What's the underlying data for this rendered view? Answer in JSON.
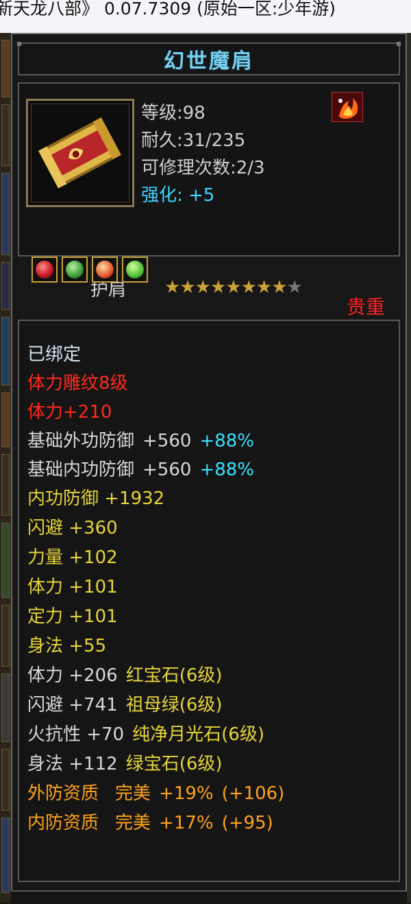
{
  "window": {
    "title": "新天龙八部》 0.07.7309 (原始一区:少年游)"
  },
  "item": {
    "name": "幻世魔肩",
    "stats": {
      "level": "等级:98",
      "durability": "耐久:31/235",
      "repairs": "可修理次数:2/3",
      "enhance": "强化: +5"
    },
    "type": "护肩",
    "stars": {
      "filled": 8,
      "total": 9
    },
    "rarity": "贵重",
    "gems": [
      {
        "name": "red-gem-icon",
        "color": "#d11f2a"
      },
      {
        "name": "green-gem-icon",
        "color": "#3a9b34"
      },
      {
        "name": "flame-gem-icon",
        "color": "#e0502a"
      },
      {
        "name": "emerald-gem-icon",
        "color": "#4bbf35"
      }
    ]
  },
  "properties": {
    "bound": "已绑定",
    "engrave": "体力雕纹8级",
    "engrave_bonus": "体力+210",
    "base_outer_def": {
      "label": "基础外功防御",
      "value": "+560",
      "pct": "+88%"
    },
    "base_inner_def": {
      "label": "基础内功防御",
      "value": "+560",
      "pct": "+88%"
    },
    "inner_def": "内功防御 +1932",
    "dodge": "闪避 +360",
    "strength": "力量 +102",
    "stamina": "体力 +101",
    "focus": "定力 +101",
    "agility": "身法 +55",
    "gem1": {
      "stat": "体力 +206",
      "gem": "红宝石(6级)"
    },
    "gem2": {
      "stat": "闪避 +741",
      "gem": "祖母绿(6级)"
    },
    "gem3": {
      "stat": "火抗性 +70",
      "gem": "纯净月光石(6级)"
    },
    "gem4": {
      "stat": "身法 +112",
      "gem": "绿宝石(6级)"
    },
    "quality1": {
      "label": "外防资质",
      "grade": "完美",
      "pct": "+19%",
      "bonus": "(+106)"
    },
    "quality2": {
      "label": "内防资质",
      "grade": "完美",
      "pct": "+17%",
      "bonus": "(+95)"
    }
  },
  "colors": {
    "name": "#78cfee",
    "enhance": "#3fd6ff",
    "red": "#ff2a1e",
    "yellow": "#e7d53a",
    "orange": "#ffa21c",
    "cyan": "#37e2ff"
  }
}
